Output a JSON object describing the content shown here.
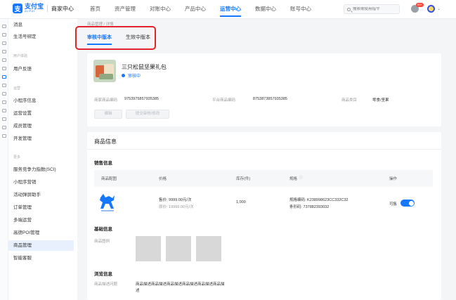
{
  "brand": {
    "logo_mark": "支",
    "name": "支付宝",
    "name_en": "ALIPAY",
    "subtitle": "商家中心"
  },
  "nav": {
    "items": [
      "首页",
      "资产管理",
      "对账中心",
      "产品中心",
      "运营中心",
      "数据中心",
      "账号中心"
    ],
    "active": "运营中心"
  },
  "search": {
    "placeholder": "搜索或使用指令"
  },
  "header": {
    "badge": "99+"
  },
  "sidebar": {
    "items_top": [
      "消息",
      "生活号绑定"
    ],
    "group_user": "用户体验",
    "items_user": [
      "用户反馈"
    ],
    "group_tools": "运营",
    "items_tools": [
      "小程序信息",
      "运营设置",
      "成员管理",
      "开发管理"
    ],
    "group_more": "更多",
    "items_more": [
      "服务竞争力指数(SCI)",
      "小程序营销",
      "活动弹屏助手",
      "订单管理",
      "多端运营",
      "高德POI管理",
      "商品管理",
      "智能客服"
    ],
    "active": "商品管理"
  },
  "breadcrumb": "商品管理 / 详情",
  "tabs": [
    {
      "label": "审核中版本"
    },
    {
      "label": "生效中版本"
    }
  ],
  "product": {
    "name": "三只松鼠坚果礼包",
    "status": "审核中",
    "info": {
      "merchant_code_label": "商家商品编码",
      "merchant_code": "9753975857935385",
      "platform_code_label": "平台商品编码",
      "platform_code": "8753873857935385",
      "category_label": "商品类目",
      "category": "零食/坚果"
    },
    "buttons": {
      "edit": "编辑",
      "submit": "提交审核/修改"
    }
  },
  "goods_info": {
    "title": "商品信息",
    "sales_title": "销售信息",
    "table": {
      "headers": [
        "商品配图",
        "价格",
        "库存(件)",
        "规格",
        "操作"
      ],
      "row": {
        "price": "售价: 9999.00元/次",
        "original_price": "原价: 19999.00元/次",
        "stock": "1,000",
        "spec_code": "规格编码: K238998623CC332C32",
        "barcode": "条形码: 737882393032",
        "op_label": "可售",
        "enabled": true
      }
    },
    "basic_title": "基础信息",
    "gallery_label": "商品图例",
    "browse_title": "浏览信息",
    "desc_label": "商品描述问题",
    "desc_text": "商品描述商品描述商品描述商品描述商品描述商品描述"
  }
}
